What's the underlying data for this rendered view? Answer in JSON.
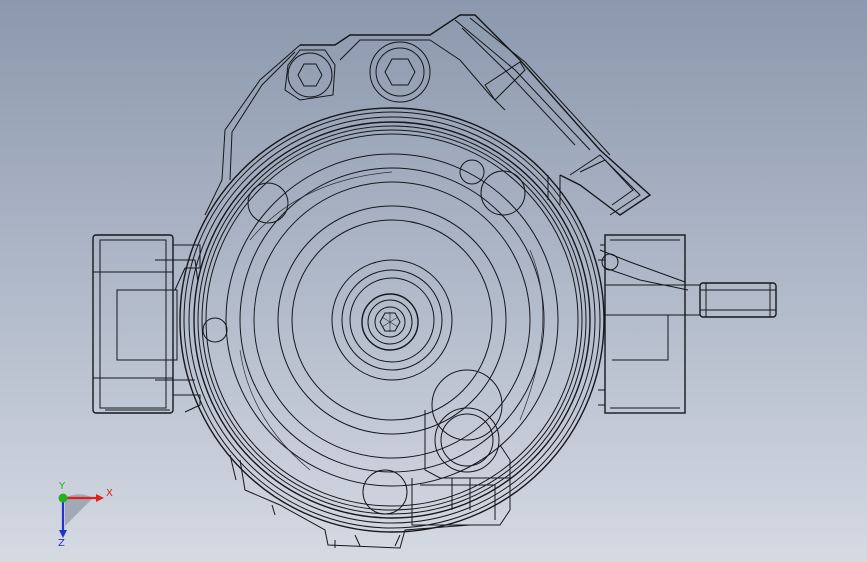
{
  "view": {
    "model": "compressor-wireframe",
    "display_style": "hidden-lines-visible",
    "colors": {
      "background_top": "#8c98ad",
      "background_bottom": "#d5dae3",
      "line": "#15171c"
    }
  },
  "triad": {
    "x_label": "X",
    "y_label": "Y",
    "z_label": "Z",
    "x_color": "#e0201b",
    "y_color": "#1fb31f",
    "z_color": "#2233cc"
  }
}
